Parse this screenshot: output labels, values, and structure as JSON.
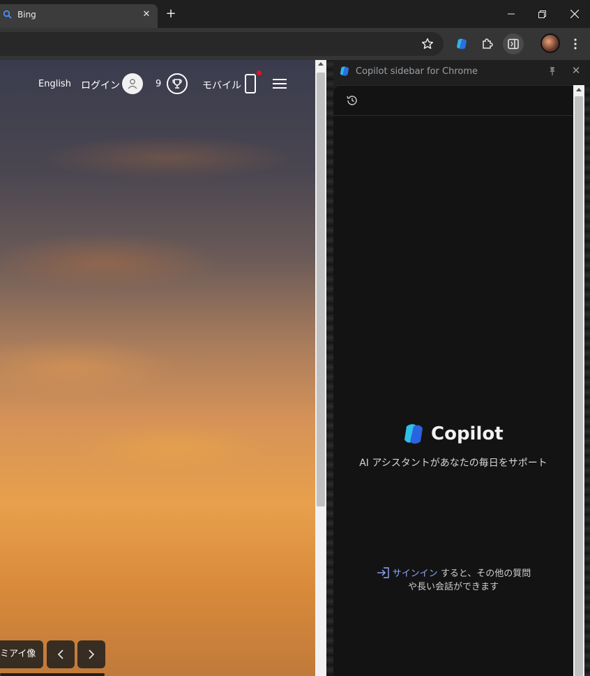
{
  "browser": {
    "tab": {
      "title": "Bing"
    },
    "new_tab_label": "+"
  },
  "bing": {
    "header": {
      "language": "English",
      "login": "ログイン",
      "points": "9",
      "mobile": "モバイル"
    },
    "caption": "ミアイ像"
  },
  "sidebar": {
    "title": "Copilot sidebar for Chrome",
    "brand": "Copilot",
    "tagline": "AI アシスタントがあなたの毎日をサポート",
    "signin_link": "サインイン",
    "signin_text_1": " すると、その他の質問",
    "signin_text_2": "や長い会話ができます"
  },
  "colors": {
    "accent_link": "#8ea7ff",
    "notification_dot": "#e81123"
  }
}
